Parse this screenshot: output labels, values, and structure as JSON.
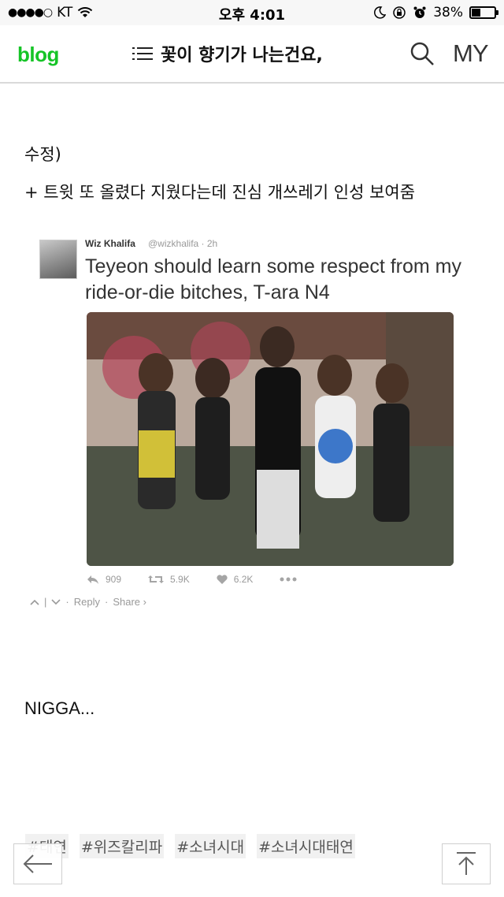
{
  "status_bar": {
    "signal": "●●●●○",
    "carrier": "KT",
    "time": "오후 4:01",
    "battery_percent": "38%",
    "battery_level": 0.38
  },
  "nav": {
    "logo": "blog",
    "title": "꽃이 향기가 나는건요,",
    "my_label": "MY"
  },
  "post": {
    "line1": "수정)",
    "line2": "+ 트윗 또 올렸다 지웠다는데 진심 개쓰레기 인성 보여줌",
    "line3": "NIGGA...",
    "tweet": {
      "name": "Wiz Khalifa",
      "handle": "@wizkhalifa · 2h",
      "text": "Teyeon should learn some respect from my ride-or-die bitches, T-ara N4",
      "reply_count": "909",
      "retweet_count": "5.9K",
      "like_count": "6.2K",
      "reply_label": "Reply",
      "share_label": "Share ›"
    },
    "tags": [
      "#태연",
      "#위즈칼리파",
      "#소녀시대",
      "#소녀시대태연"
    ]
  }
}
